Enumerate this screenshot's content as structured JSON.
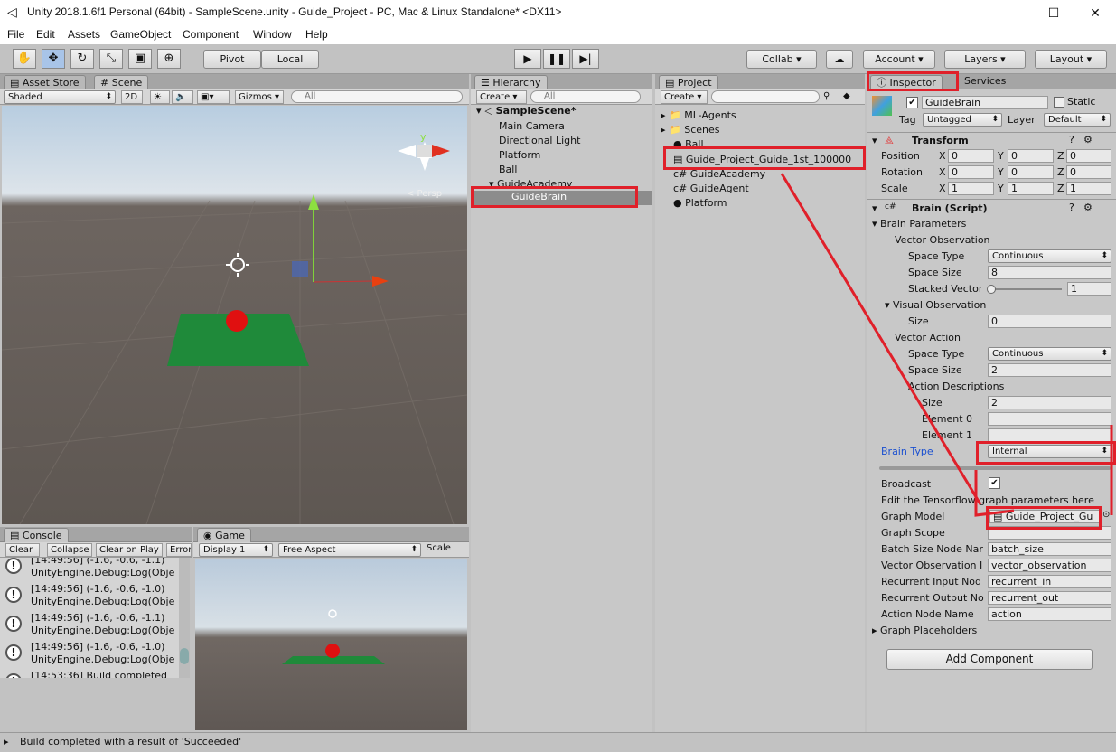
{
  "window": {
    "title": "Unity 2018.1.6f1 Personal (64bit) - SampleScene.unity - Guide_Project - PC, Mac & Linux Standalone* <DX11>"
  },
  "menu": [
    "File",
    "Edit",
    "Assets",
    "GameObject",
    "Component",
    "Window",
    "Help"
  ],
  "toolbar": {
    "pivot": "Pivot",
    "local": "Local",
    "collab": "Collab",
    "account": "Account",
    "layers": "Layers",
    "layout": "Layout"
  },
  "scene": {
    "tab_asset_store": "Asset Store",
    "tab_scene": "Scene",
    "shaded": "Shaded",
    "twod": "2D",
    "gizmos": "Gizmos",
    "search_placeholder": "All",
    "persp": "Persp"
  },
  "hierarchy": {
    "tab": "Hierarchy",
    "create": "Create",
    "search_placeholder": "All",
    "scene_name": "SampleScene*",
    "items": [
      "Main Camera",
      "Directional Light",
      "Platform",
      "Ball",
      "GuideAcademy",
      "GuideBrain"
    ]
  },
  "project": {
    "tab": "Project",
    "create": "Create",
    "items": [
      "ML-Agents",
      "Scenes",
      "Ball",
      "Guide_Project_Guide_1st_100000",
      "GuideAcademy",
      "GuideAgent",
      "Platform"
    ]
  },
  "inspector": {
    "tab": "Inspector",
    "services": "Services",
    "object_name": "GuideBrain",
    "static": "Static",
    "tag_label": "Tag",
    "tag_value": "Untagged",
    "layer_label": "Layer",
    "layer_value": "Default",
    "transform": "Transform",
    "position": "Position",
    "rotation": "Rotation",
    "scale": "Scale",
    "pos": [
      "0",
      "0",
      "0"
    ],
    "rot": [
      "0",
      "0",
      "0"
    ],
    "scl": [
      "1",
      "1",
      "1"
    ],
    "brain_script": "Brain (Script)",
    "brain_params": "Brain Parameters",
    "vector_obs": "Vector Observation",
    "space_type": "Space Type",
    "space_type_val": "Continuous",
    "space_size": "Space Size",
    "space_size_val": "8",
    "stacked": "Stacked Vector",
    "stacked_val": "1",
    "visual_obs": "Visual Observation",
    "size": "Size",
    "visual_size_val": "0",
    "vector_action": "Vector Action",
    "action_space_type_val": "Continuous",
    "action_space_size_val": "2",
    "action_desc": "Action Descriptions",
    "action_desc_size": "2",
    "element0": "Element 0",
    "element1": "Element 1",
    "brain_type": "Brain Type",
    "brain_type_val": "Internal",
    "broadcast": "Broadcast",
    "edit_tf": "Edit the Tensorflow graph parameters here",
    "graph_model": "Graph Model",
    "graph_model_val": "Guide_Project_Gu",
    "graph_scope": "Graph Scope",
    "batch_size": "Batch Size Node Nar",
    "batch_size_val": "batch_size",
    "vector_obs_node": "Vector Observation I",
    "vector_obs_node_val": "vector_observation",
    "rec_in": "Recurrent Input Nod",
    "rec_in_val": "recurrent_in",
    "rec_out": "Recurrent Output No",
    "rec_out_val": "recurrent_out",
    "action_node": "Action Node Name",
    "action_node_val": "action",
    "graph_placeholders": "Graph Placeholders",
    "add_component": "Add Component"
  },
  "console": {
    "tab": "Console",
    "clear": "Clear",
    "collapse": "Collapse",
    "clear_on_play": "Clear on Play",
    "error": "Error",
    "rows": [
      {
        "l1": "[14:49:56] (-1.6, -0.6, -1.1)",
        "l2": "UnityEngine.Debug:Log(Obje"
      },
      {
        "l1": "[14:49:56] (-1.6, -0.6, -1.0)",
        "l2": "UnityEngine.Debug:Log(Obje"
      },
      {
        "l1": "[14:49:56] (-1.6, -0.6, -1.1)",
        "l2": "UnityEngine.Debug:Log(Obje"
      },
      {
        "l1": "[14:49:56] (-1.6, -0.6, -1.0)",
        "l2": "UnityEngine.Debug:Log(Obje"
      }
    ],
    "last": "[14:53:36] Build completed"
  },
  "game": {
    "tab": "Game",
    "display": "Display 1",
    "aspect": "Free Aspect",
    "scale": "Scale"
  },
  "status": "Build completed with a result of 'Succeeded'"
}
